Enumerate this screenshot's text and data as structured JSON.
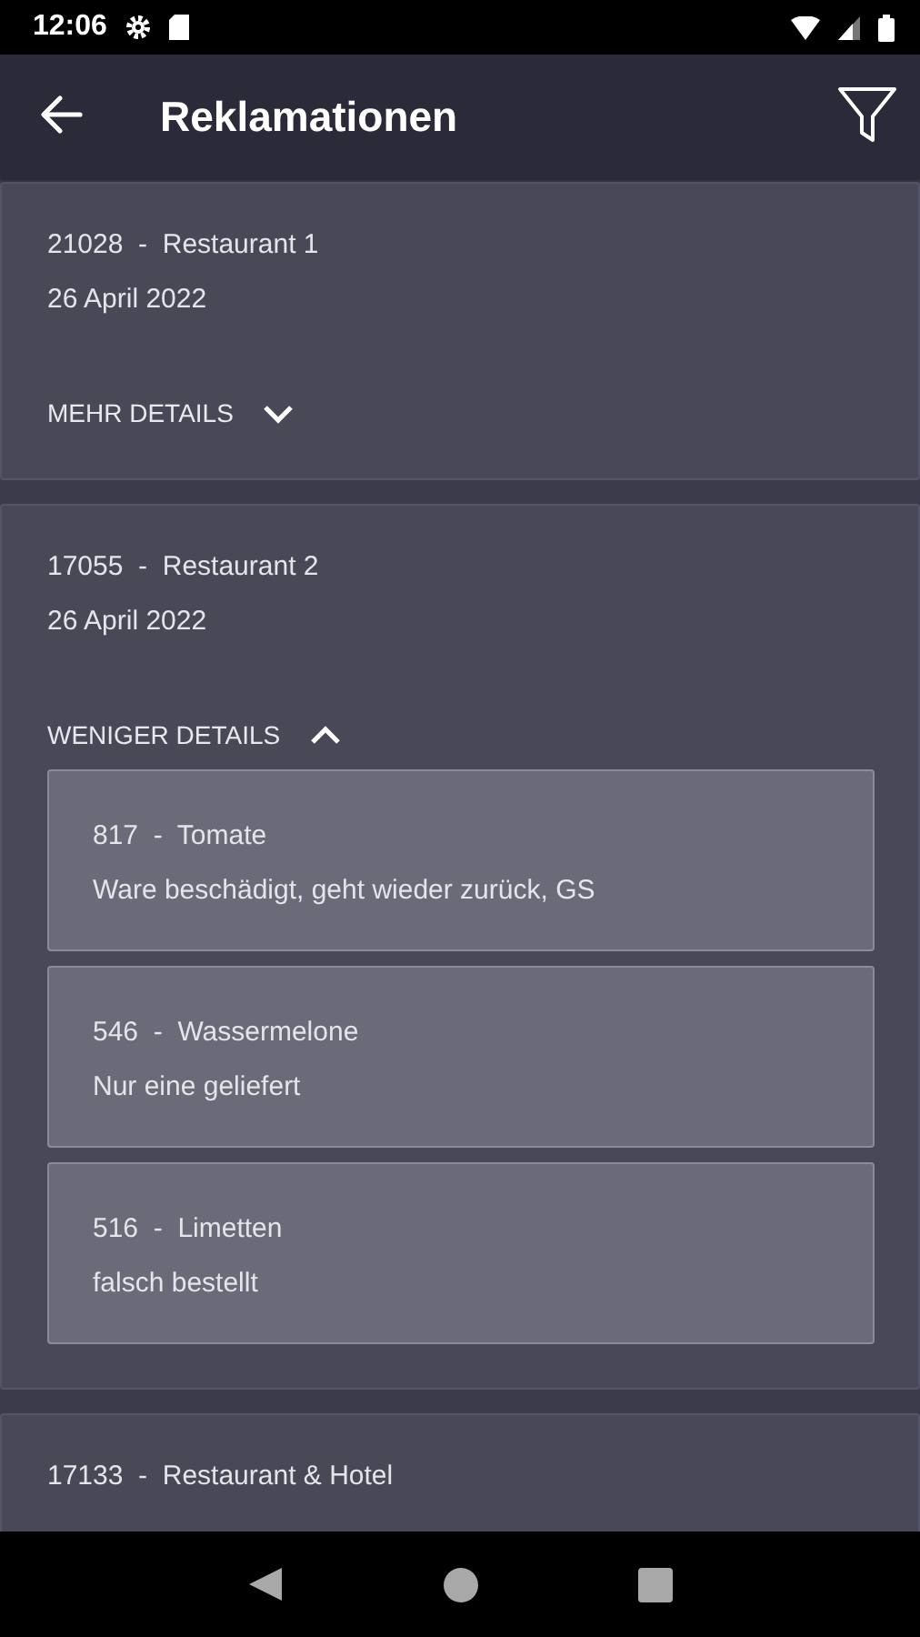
{
  "status_bar": {
    "time": "12:06"
  },
  "app_bar": {
    "title": "Reklamationen"
  },
  "claims": [
    {
      "title": "21028  -  Restaurant 1",
      "date": "26 April 2022",
      "toggle_label": "MEHR DETAILS",
      "expanded": false
    },
    {
      "title": "17055  -  Restaurant 2",
      "date": "26 April 2022",
      "toggle_label": "WENIGER DETAILS",
      "expanded": true,
      "items": [
        {
          "title": "817  -  Tomate",
          "note": "Ware beschädigt, geht wieder zurück, GS"
        },
        {
          "title": "546  -  Wassermelone",
          "note": "Nur eine geliefert"
        },
        {
          "title": "516  -  Limetten",
          "note": "falsch bestellt"
        }
      ]
    },
    {
      "title": "17133  -  Restaurant & Hotel"
    }
  ]
}
